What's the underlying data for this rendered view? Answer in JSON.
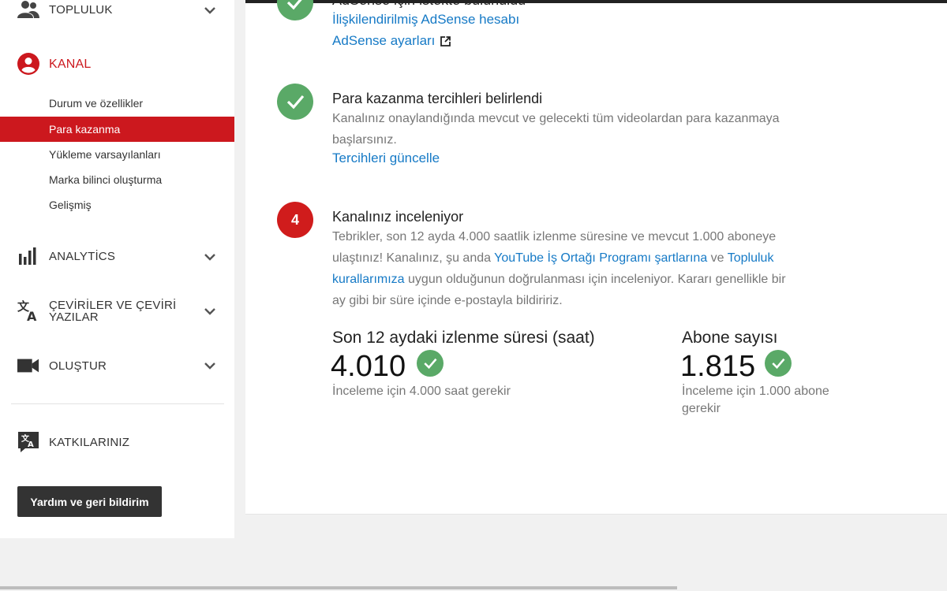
{
  "sidebar": {
    "community_label": "TOPLULUK",
    "channel_label": "KANAL",
    "channel_items": [
      {
        "label": "Durum ve özellikler"
      },
      {
        "label": "Para kazanma"
      },
      {
        "label": "Yükleme varsayılanları"
      },
      {
        "label": "Marka bilinci oluşturma"
      },
      {
        "label": "Gelişmiş"
      }
    ],
    "analytics_label": "ANALYTİCS",
    "translations_label_line1": "ÇEVİRİLER VE ÇEVİRİ",
    "translations_label_line2": "YAZILAR",
    "create_label": "OLUŞTUR",
    "contributions_label": "KATKILARINIZ",
    "help_button": "Yardım ve geri bildirim"
  },
  "main": {
    "adsense": {
      "title_partial": "AdSense için istekte bulunuldu",
      "linked_account": "İlişkilendirilmiş AdSense hesabı",
      "settings_link": "AdSense ayarları"
    },
    "preferences": {
      "title": "Para kazanma tercihleri belirlendi",
      "desc_line1": "Kanalınız onaylandığında mevcut ve gelecekti tüm videolardan para kazanmaya",
      "desc_line2": "başlarsınız.",
      "update_link": "Tercihleri güncelle"
    },
    "review": {
      "step_number": "4",
      "title": "Kanalınız inceleniyor",
      "line1": "Tebrikler, son 12 ayda 4.000 saatlik izlenme süresine ve mevcut 1.000 aboneye",
      "line2_a": "ulaştınız! Kanalınız, şu anda ",
      "line2_link": "YouTube İş Ortağı Programı şartlarına",
      "line2_b": " ve ",
      "line2_link2": "Topluluk",
      "line3_link": "kurallarımıza",
      "line3_b": " uygun olduğunun doğrulanması için inceleniyor. Kararı genellikle bir",
      "line4": "ay gibi bir süre içinde e-postayla bildiririz."
    },
    "stats": [
      {
        "title": "Son 12 aydaki izlenme süresi (saat)",
        "value": "4.010",
        "note_line1": "İnceleme için 4.000 saat gerekir",
        "note_line2": ""
      },
      {
        "title": "Abone sayısı",
        "value": "1.815",
        "note_line1": "İnceleme için 1.000 abone",
        "note_line2": "gerekir"
      }
    ]
  },
  "colors": {
    "accent_red": "#cc181e",
    "success_green": "#5aa967",
    "link_blue": "#167ac6"
  }
}
